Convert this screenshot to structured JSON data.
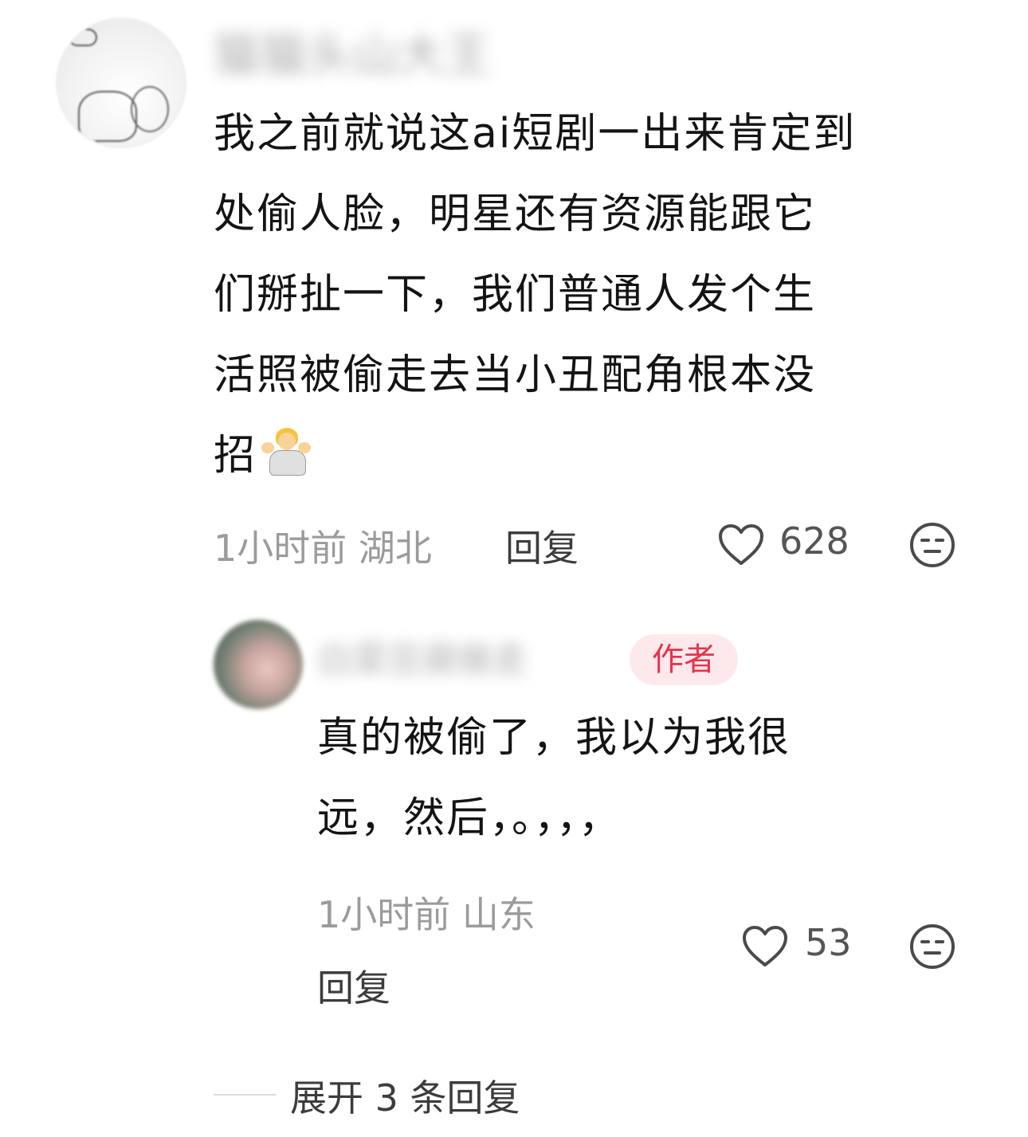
{
  "comment": {
    "username": "猫猫头山大王",
    "content_lines": [
      "我之前就说这ai短剧一出来肯定到",
      "处偷人脸，明星还有资源能跟它",
      "们掰扯一下，我们普通人发个生",
      "活照被偷走去当小丑配角根本没",
      "招"
    ],
    "content_emoji": "person-shrugging",
    "time": "1小时前",
    "location": "湖北",
    "reply_label": "回复",
    "likes": "628"
  },
  "reply": {
    "username": "白菜豆腐做走",
    "badge": "作者",
    "content_lines": [
      "真的被偷了，我以为我很",
      "远，然后，。，，，"
    ],
    "time": "1小时前",
    "location": "山东",
    "reply_label": "回复",
    "likes": "53"
  },
  "expand_label": "展开 3 条回复",
  "colors": {
    "text_primary": "#141414",
    "text_meta": "#9b9b9b",
    "badge_bg": "#fde9ec",
    "badge_text": "#e8334d"
  }
}
